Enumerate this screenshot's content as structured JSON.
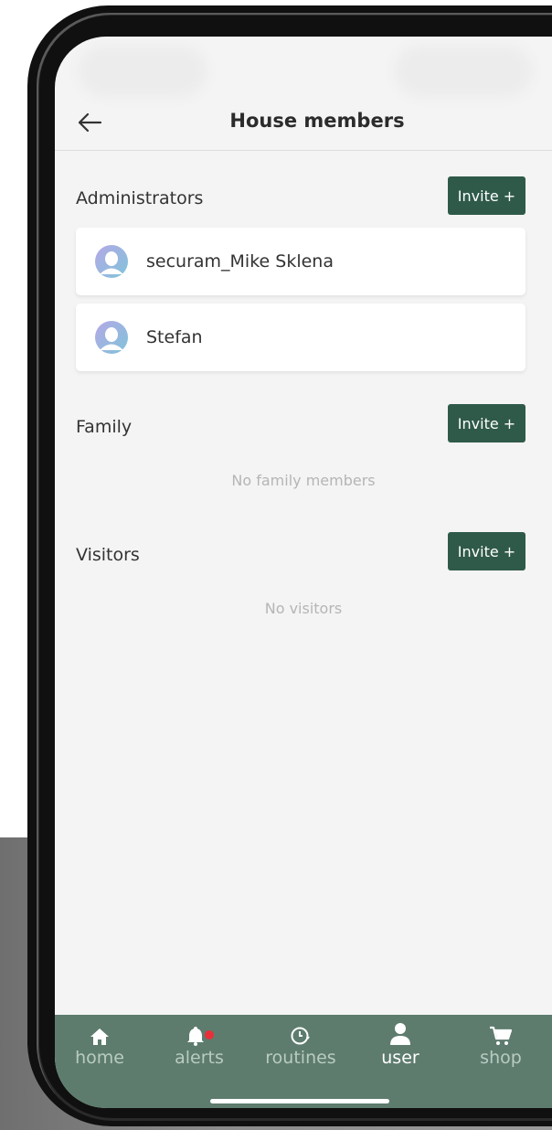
{
  "header": {
    "title": "House members"
  },
  "sections": {
    "administrators": {
      "label": "Administrators",
      "invite_label": "Invite +",
      "members": [
        {
          "name": "securam_Mike Sklena"
        },
        {
          "name": "Stefan"
        }
      ]
    },
    "family": {
      "label": "Family",
      "invite_label": "Invite +",
      "empty_text": "No family members"
    },
    "visitors": {
      "label": "Visitors",
      "invite_label": "Invite +",
      "empty_text": "No visitors"
    }
  },
  "tabbar": {
    "active": "user",
    "tabs": [
      {
        "id": "home",
        "label": "home",
        "icon": "home-icon"
      },
      {
        "id": "alerts",
        "label": "alerts",
        "icon": "bell-icon",
        "badge_color": "#e8303a"
      },
      {
        "id": "routines",
        "label": "routines",
        "icon": "clock-icon"
      },
      {
        "id": "user",
        "label": "user",
        "icon": "user-icon"
      },
      {
        "id": "shop",
        "label": "shop",
        "icon": "cart-icon"
      }
    ]
  },
  "colors": {
    "accent": "#2f5a4a",
    "tabbar": "#5d7c6e",
    "avatar": "#8fb3d9"
  }
}
